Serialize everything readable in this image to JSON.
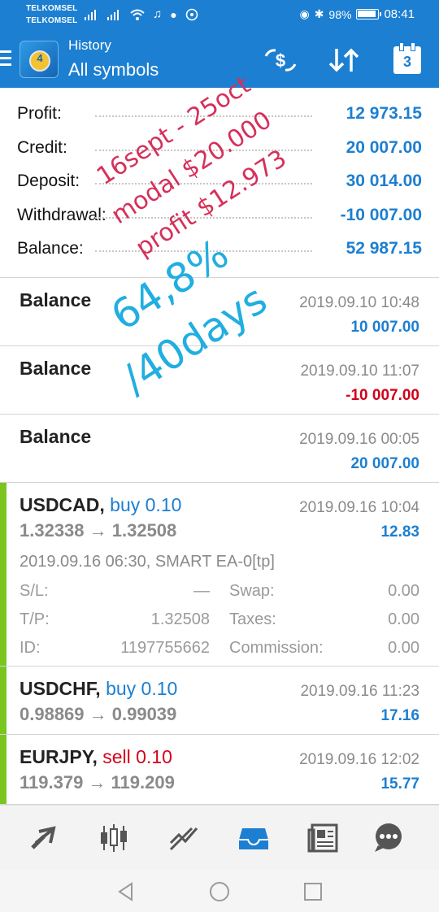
{
  "status_bar": {
    "carrier_1": "TELKOMSEL",
    "carrier_2": "TELKOMSEL",
    "battery": "98%",
    "time": "08:41"
  },
  "app_bar": {
    "subtitle": "History",
    "title": "All symbols",
    "calendar_day": "3",
    "icons": [
      "menu-icon",
      "app-logo",
      "currency-exchange-icon",
      "sort-icon",
      "calendar-icon"
    ]
  },
  "summary": {
    "profit_label": "Profit:",
    "profit_value": "12 973.15",
    "credit_label": "Credit:",
    "credit_value": "20 007.00",
    "deposit_label": "Deposit:",
    "deposit_value": "30 014.00",
    "withdrawal_label": "Withdrawal:",
    "withdrawal_value": "-10 007.00",
    "balance_label": "Balance:",
    "balance_value": "52 987.15"
  },
  "balance_ops": [
    {
      "label": "Balance",
      "date": "2019.09.10 10:48",
      "amount": "10 007.00"
    },
    {
      "label": "Balance",
      "date": "2019.09.10 11:07",
      "amount": "-10 007.00"
    },
    {
      "label": "Balance",
      "date": "2019.09.16 00:05",
      "amount": "20 007.00"
    }
  ],
  "trades": [
    {
      "symbol": "USDCAD,",
      "side": "buy 0.10",
      "prices": "1.32338 → 1.32508",
      "date": "2019.09.16 10:04",
      "profit": "12.83",
      "details": {
        "open_info": "2019.09.16 06:30, SMART EA-0[tp]",
        "sl_label": "S/L:",
        "sl_value": "—",
        "tp_label": "T/P:",
        "tp_value": "1.32508",
        "id_label": "ID:",
        "id_value": "1197755662",
        "swap_label": "Swap:",
        "swap_value": "0.00",
        "taxes_label": "Taxes:",
        "taxes_value": "0.00",
        "commission_label": "Commission:",
        "commission_value": "0.00"
      }
    },
    {
      "symbol": "USDCHF,",
      "side": "buy 0.10",
      "prices": "0.98869 → 0.99039",
      "date": "2019.09.16 11:23",
      "profit": "17.16"
    },
    {
      "symbol": "EURJPY,",
      "side": "sell 0.10",
      "prices": "119.379 → 119.209",
      "date": "2019.09.16 12:02",
      "profit": "15.77"
    }
  ],
  "handwriting": {
    "line1": "16sept - 25oct",
    "line2": "modal $20.000",
    "line3": "profit $12.973",
    "line4": "64,8%",
    "line5": "/40days"
  },
  "bottom_nav": [
    "quotes-icon",
    "chart-icon",
    "trade-icon",
    "history-icon",
    "news-icon",
    "chat-icon"
  ],
  "colors": {
    "accent": "#1c7fd1",
    "positive": "#1c7fd1",
    "negative": "#d0021b",
    "buy_bar": "#7bc51f"
  }
}
